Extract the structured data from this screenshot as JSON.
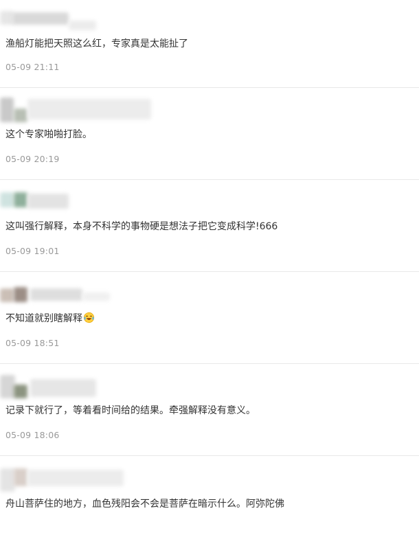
{
  "comments": [
    {
      "text": "渔船灯能把天照这么红，专家真是太能扯了",
      "time": "05-09 21:11",
      "emoji": ""
    },
    {
      "text": "这个专家啪啪打脸。",
      "time": "05-09 20:19",
      "emoji": ""
    },
    {
      "text": "这叫强行解释，本身不科学的事物硬是想法子把它变成科学!666",
      "time": "05-09 19:01",
      "emoji": ""
    },
    {
      "text": "不知道就别瞎解释",
      "time": "05-09 18:51",
      "emoji": "laugh-cry-emoji"
    },
    {
      "text": "记录下就行了，等着看时间给的结果。牵强解释没有意义。",
      "time": "05-09 18:06",
      "emoji": ""
    },
    {
      "text": "舟山菩萨住的地方，血色残阳会不会是菩萨在暗示什么。阿弥陀佛",
      "time": "",
      "emoji": ""
    }
  ],
  "colors": {
    "text": "#333333",
    "timestamp": "#999999",
    "divider": "#e8e8e8"
  }
}
